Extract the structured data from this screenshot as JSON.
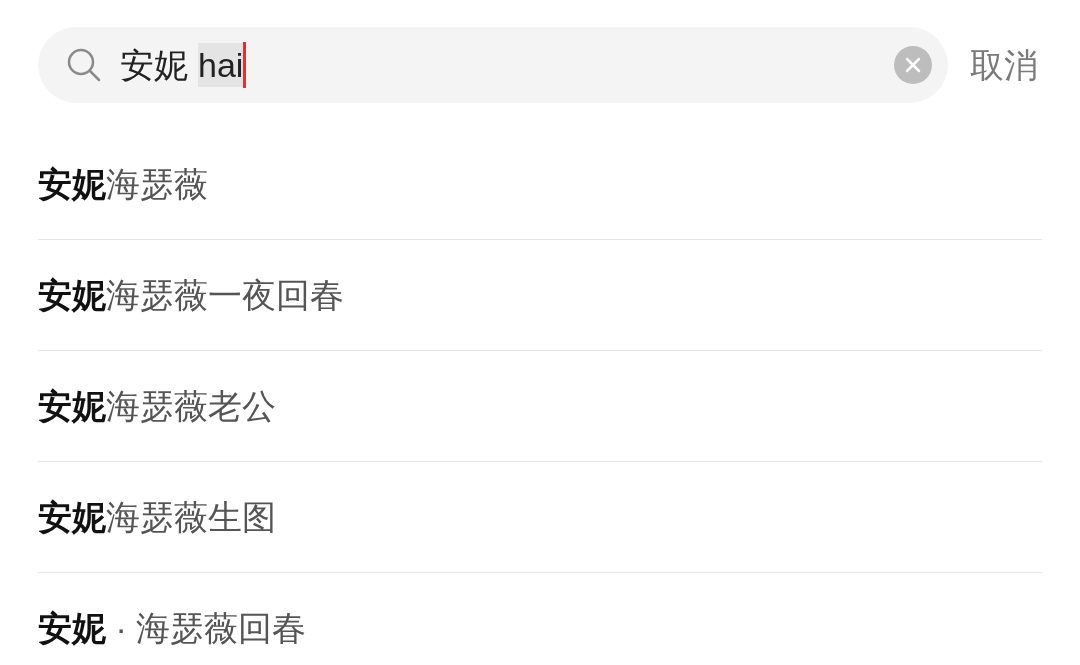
{
  "search": {
    "committed": "安妮",
    "composing": "hai",
    "cancel": "取消"
  },
  "suggestions": [
    {
      "text": "**安妮**海瑟薇"
    },
    {
      "text": "**安妮**海瑟薇一夜回春"
    },
    {
      "text": "**安妮**海瑟薇老公"
    },
    {
      "text": "**安妮**海瑟薇生图"
    },
    {
      "text": "**安妮** · 海瑟薇回春"
    }
  ]
}
